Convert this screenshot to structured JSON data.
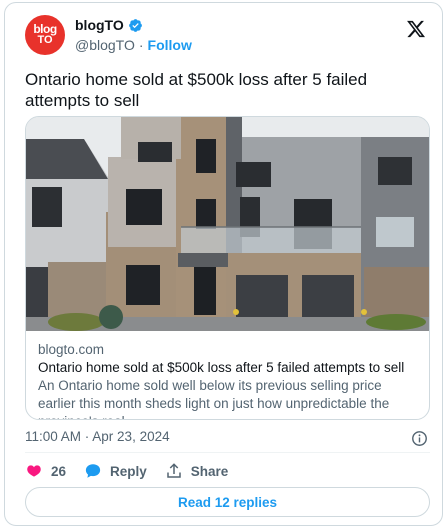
{
  "author": {
    "avatar_line1": "blog",
    "avatar_line2": "TO",
    "display_name": "blogTO",
    "handle": "@blogTO",
    "separator": "·",
    "follow_label": "Follow",
    "verified_icon": "verified-badge-icon"
  },
  "tweet": {
    "text": "Ontario home sold at $500k loss after 5 failed attempts to sell",
    "timestamp": "11:00 AM · Apr 23, 2024"
  },
  "link_card": {
    "domain": "blogto.com",
    "title": "Ontario home sold at $500k loss after 5 failed attempts to sell",
    "description": "An Ontario home sold well below its previous selling price earlier this month sheds light on just how unpredictable the province's real ..."
  },
  "actions": {
    "likes": "26",
    "reply_label": "Reply",
    "share_label": "Share"
  },
  "footer": {
    "read_replies_label": "Read 12 replies"
  },
  "colors": {
    "accent": "#1d9bf0",
    "like": "#f91880",
    "brand": "#e8322b"
  }
}
